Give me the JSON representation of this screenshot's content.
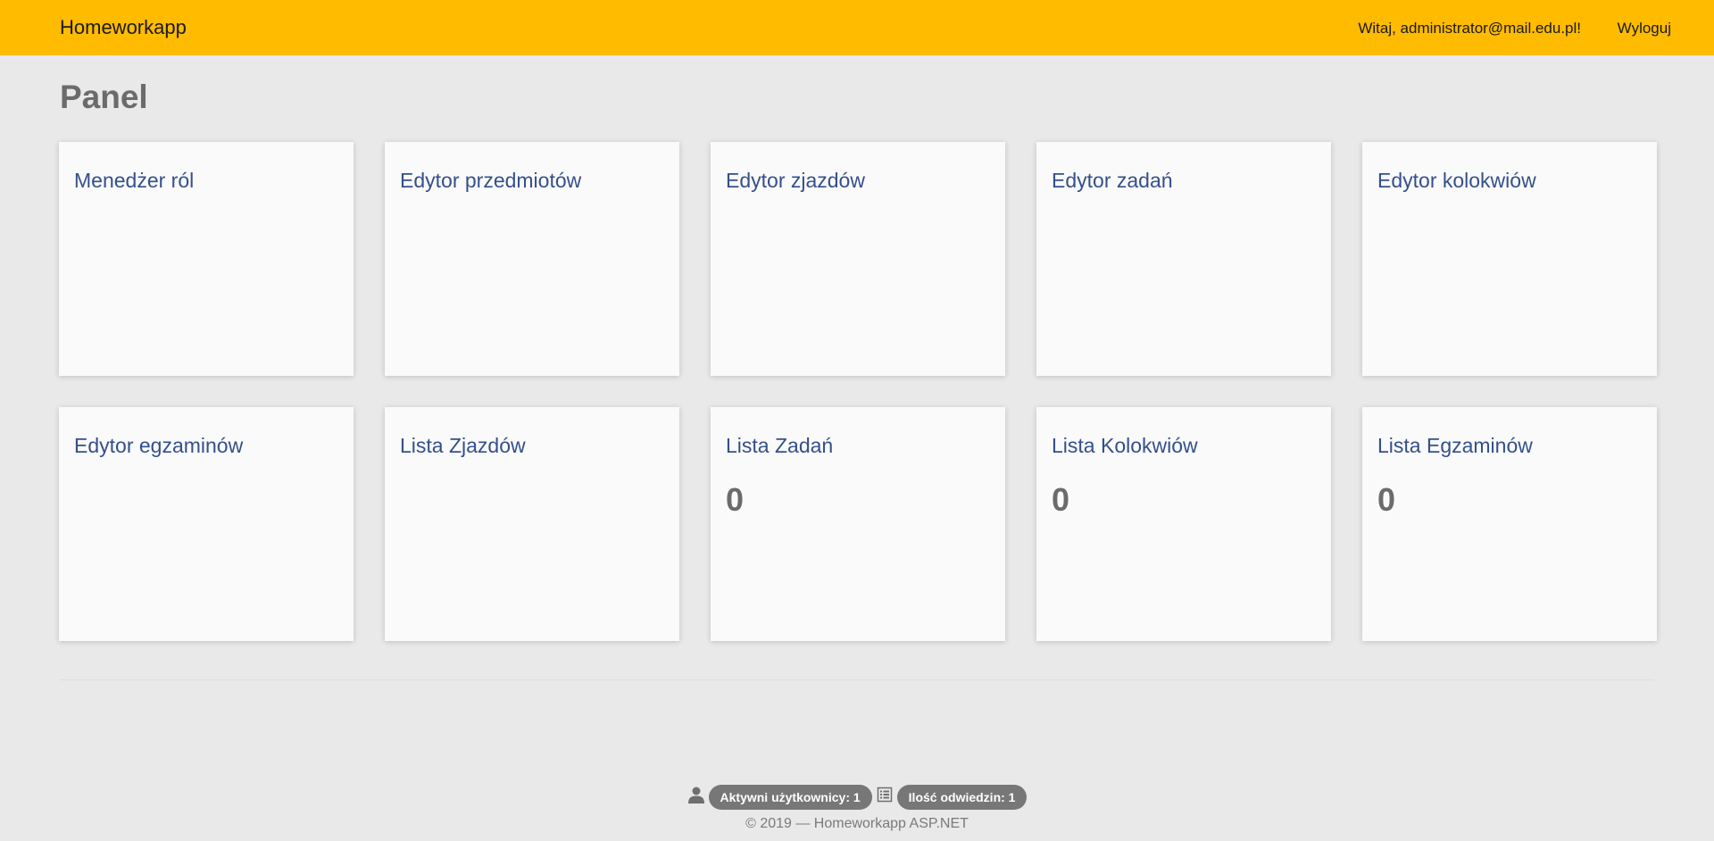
{
  "navbar": {
    "brand": "Homeworkapp",
    "greeting": "Witaj, administrator@mail.edu.pl!",
    "logout_label": "Wyloguj",
    "background_color": "#ffbb00"
  },
  "page": {
    "title": "Panel"
  },
  "tiles": [
    {
      "title": "Menedżer ról",
      "count": null
    },
    {
      "title": "Edytor przedmiotów",
      "count": null
    },
    {
      "title": "Edytor zjazdów",
      "count": null
    },
    {
      "title": "Edytor zadań",
      "count": null
    },
    {
      "title": "Edytor kolokwiów",
      "count": null
    },
    {
      "title": "Edytor egzaminów",
      "count": null
    },
    {
      "title": "Lista Zjazdów",
      "count": null
    },
    {
      "title": "Lista Zadań",
      "count": "0"
    },
    {
      "title": "Lista Kolokwiów",
      "count": "0"
    },
    {
      "title": "Lista Egzaminów",
      "count": "0"
    }
  ],
  "footer": {
    "active_users_icon": "user-icon",
    "active_users_label": "Aktywni użytkownicy: 1",
    "visits_icon": "list-icon",
    "visits_label": "Ilość odwiedzin: 1",
    "copyright": "© 2019 — Homeworkapp ASP.NET"
  }
}
